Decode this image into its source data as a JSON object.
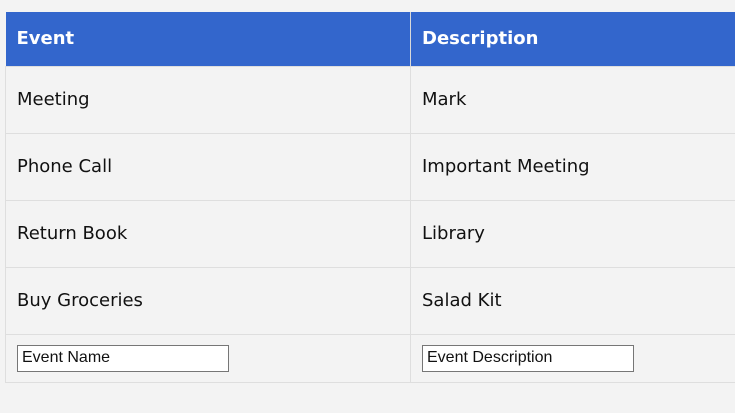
{
  "table": {
    "headers": [
      "Event",
      "Description"
    ],
    "rows": [
      {
        "event": "Meeting",
        "description": "Mark"
      },
      {
        "event": "Phone Call",
        "description": "Important Meeting"
      },
      {
        "event": "Return Book",
        "description": "Library"
      },
      {
        "event": "Buy Groceries",
        "description": "Salad Kit"
      }
    ],
    "inputs": {
      "event_placeholder": "Event Name",
      "description_placeholder": "Event Description"
    }
  },
  "colors": {
    "header_bg": "#3366cc",
    "header_text": "#ffffff",
    "page_bg": "#f3f3f3"
  }
}
